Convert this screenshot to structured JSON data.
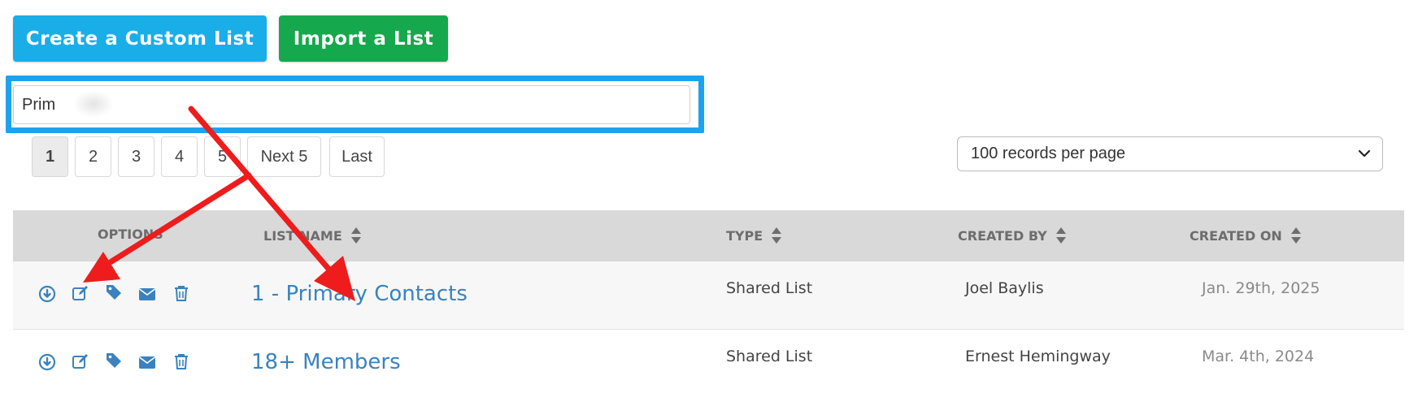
{
  "toolbar": {
    "create_label": "Create a Custom List",
    "import_label": "Import a List"
  },
  "search": {
    "value": "Prim"
  },
  "pagination": {
    "pages": [
      "1",
      "2",
      "3",
      "4",
      "5"
    ],
    "next_label": "Next 5",
    "last_label": "Last",
    "active_page": "1"
  },
  "per_page": {
    "selected": "100 records per page"
  },
  "table": {
    "headers": {
      "options": "OPTIONS",
      "list_name": "LIST NAME",
      "type": "TYPE",
      "created_by": "CREATED BY",
      "created_on": "CREATED ON"
    },
    "rows": [
      {
        "list_name": "1 - Primary Contacts",
        "type": "Shared List",
        "created_by": "Joel Baylis",
        "created_on": "Jan. 29th, 2025"
      },
      {
        "list_name": "18+ Members",
        "type": "Shared List",
        "created_by": "Ernest Hemingway",
        "created_on": "Mar. 4th, 2024"
      }
    ],
    "option_icons": [
      "download-icon",
      "edit-icon",
      "tag-icon",
      "envelope-icon",
      "trash-icon"
    ]
  },
  "colors": {
    "primary_button": "#1aaee8",
    "import_button": "#16a84c",
    "highlight": "#1ba3ef",
    "link": "#3a82bf",
    "annotation_arrow": "#ee1c1c"
  }
}
